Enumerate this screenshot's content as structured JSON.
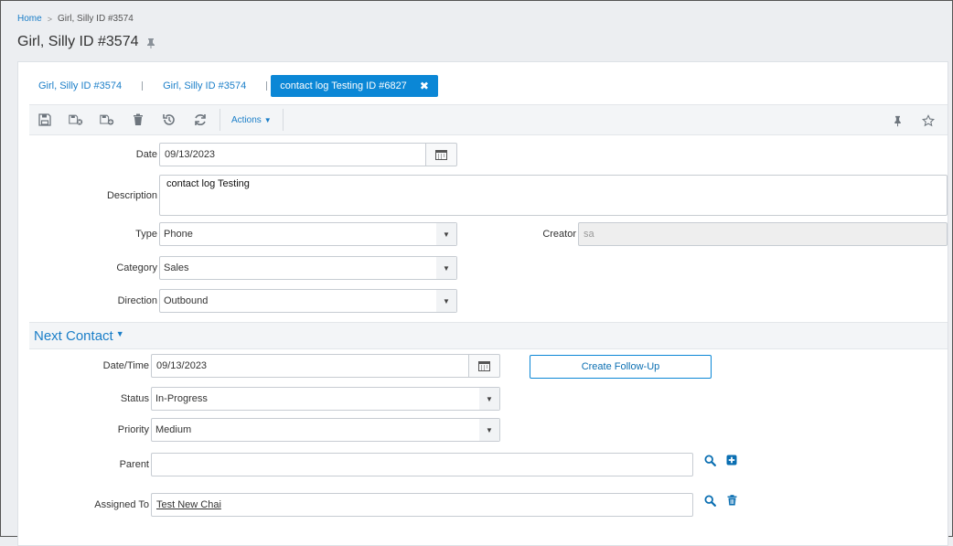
{
  "breadcrumb": {
    "home": "Home",
    "current": "Girl, Silly ID #3574"
  },
  "page": {
    "title": "Girl, Silly ID #3574"
  },
  "tabs": [
    {
      "label": "Girl, Silly ID #3574"
    },
    {
      "label": "Girl, Silly ID #3574"
    },
    {
      "label": "contact log Testing ID #6827",
      "close": "✖"
    }
  ],
  "toolbar": {
    "actions_label": "Actions",
    "actions_caret": "▼"
  },
  "form": {
    "date": {
      "label": "Date",
      "value": "09/13/2023"
    },
    "description": {
      "label": "Description",
      "value": "contact log Testing"
    },
    "type": {
      "label": "Type",
      "value": "Phone"
    },
    "creator": {
      "label": "Creator",
      "value": "sa"
    },
    "category": {
      "label": "Category",
      "value": "Sales"
    },
    "direction": {
      "label": "Direction",
      "value": "Outbound"
    }
  },
  "next_contact": {
    "title": "Next Contact",
    "caret": "▼",
    "datetime": {
      "label": "Date/Time",
      "value": "09/13/2023"
    },
    "create_followup": "Create Follow-Up",
    "status": {
      "label": "Status",
      "value": "In-Progress"
    },
    "priority": {
      "label": "Priority",
      "value": "Medium"
    },
    "parent": {
      "label": "Parent",
      "value": ""
    },
    "assigned_to": {
      "label": "Assigned To",
      "value": "Test New Chai"
    }
  },
  "caret_glyph": "▼",
  "colors": {
    "accent": "#0b87d6",
    "link": "#1a7ec8"
  }
}
